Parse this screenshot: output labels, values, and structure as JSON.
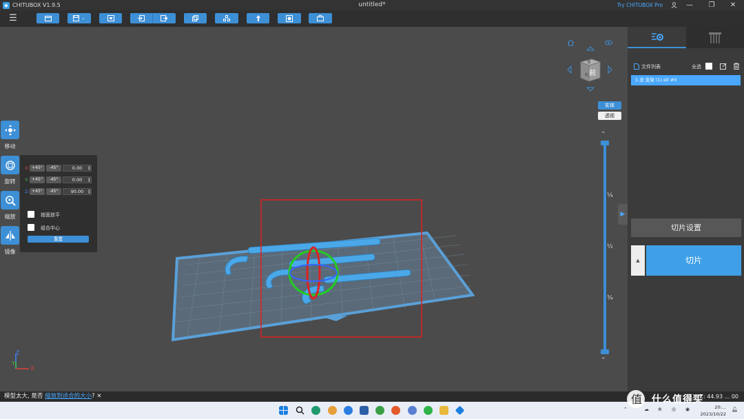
{
  "titlebar": {
    "app_name": "CHITUBOX V1.9.5",
    "doc_title": "untitled*",
    "try_pro": "Try CHITUBOX Pro",
    "controls": [
      "user-icon",
      "minimize-icon",
      "restore-icon",
      "close-icon"
    ]
  },
  "toolbar": {
    "menu_icon": "☰",
    "buttons": [
      "open-icon",
      "save-icon",
      "layout-icon",
      "import-icon",
      "export-icon",
      "copy-icon",
      "arrange-icon",
      "support-icon",
      "hollow-icon",
      "print-icon"
    ]
  },
  "tools": [
    {
      "label": "移动",
      "icon": "✥"
    },
    {
      "label": "旋转",
      "icon": "⟳"
    },
    {
      "label": "缩放",
      "icon": "⊕"
    },
    {
      "label": "镜像",
      "icon": "⇋"
    }
  ],
  "rotate": {
    "rows": [
      {
        "axis": "X:",
        "plus": "+45°",
        "minus": "-45°",
        "value": "0.00",
        "color": "#e04040"
      },
      {
        "axis": "Y:",
        "plus": "+45°",
        "minus": "-45°",
        "value": "0.00",
        "color": "#40c040"
      },
      {
        "axis": "Z:",
        "plus": "+45°",
        "minus": "-45°",
        "value": "90.00",
        "color": "#4080ff"
      }
    ],
    "flat_label": "按面放平",
    "group_center_label": "组合中心",
    "reset_label": "重置"
  },
  "nav_cube": {
    "front_label": "前",
    "top_label": "顶",
    "right_label": "右"
  },
  "view_mode": {
    "solid": "实体",
    "transparent": "透视"
  },
  "layer_slider": {
    "marks": [
      "¼",
      "½",
      "¾"
    ]
  },
  "gizmo": {
    "z": "Z",
    "y": "Y",
    "x": "X"
  },
  "right_panel": {
    "file_list_label": "文件列表",
    "select_all_label": "全选",
    "files": [
      "1.龙 支架 (1).stl #0"
    ],
    "slice_settings_label": "切片设置",
    "slice_label": "切片",
    "slice_arrow": "▲"
  },
  "status": {
    "prefix": "模型太大, 是否",
    "link": "缩放到适合的大小",
    "suffix": "?",
    "close": "✕",
    "right_text": "XYZ: 44.93 ...    00"
  },
  "taskbar": {
    "date": "2023/10/22",
    "time": "20:..."
  },
  "watermark": {
    "text": "什么值得买"
  },
  "colors": {
    "accent": "#3d8fd6",
    "plate": "#5a9fd4",
    "model": "#4aa8e8",
    "selection_box": "#e02020"
  }
}
